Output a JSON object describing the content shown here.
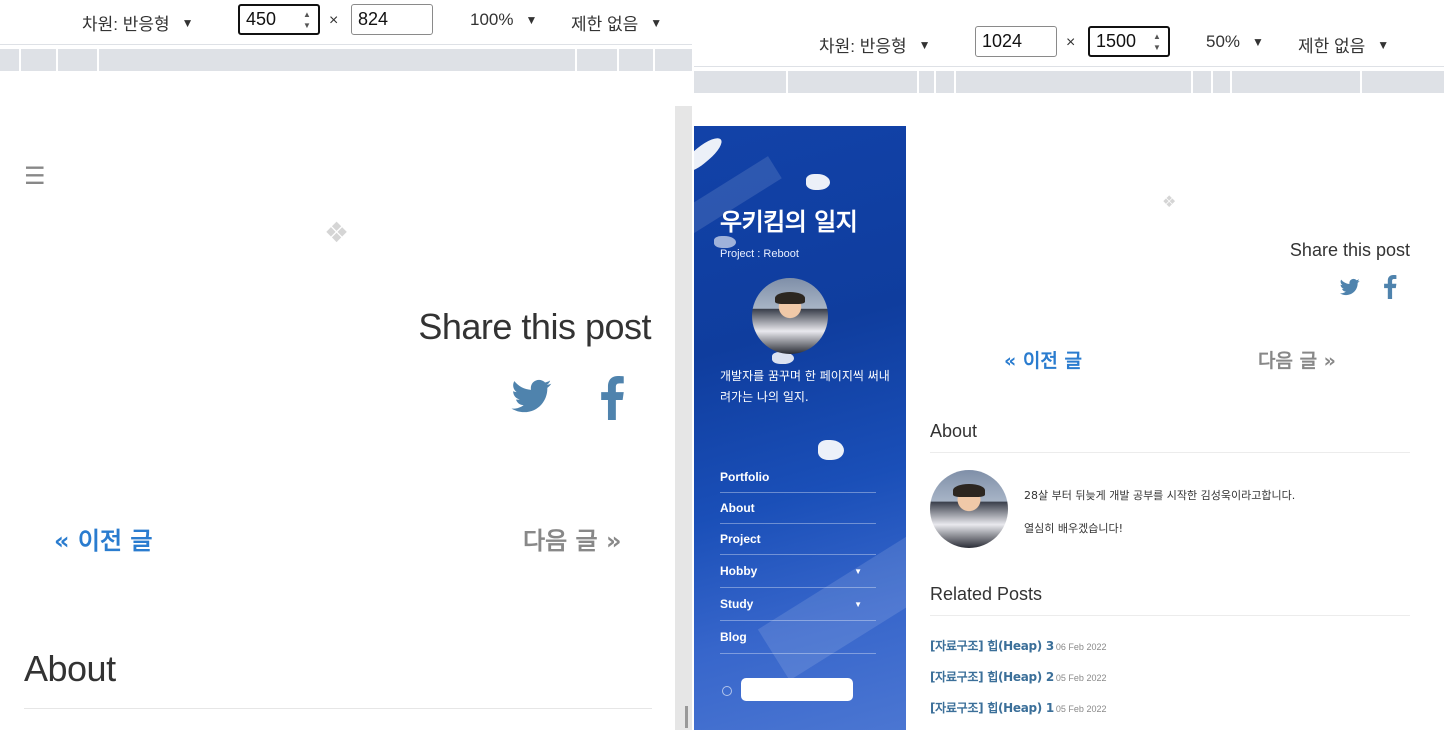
{
  "left_toolbar": {
    "dimension_label": "차원: 반응형",
    "width_value": "450",
    "height_value": "824",
    "times": "×",
    "zoom": "100%",
    "throttle": "제한 없음"
  },
  "right_toolbar": {
    "dimension_label": "차원: 반응형",
    "width_value": "1024",
    "height_value": "1500",
    "times": "×",
    "zoom": "50%",
    "throttle": "제한 없음"
  },
  "icons": {
    "menu": "☰",
    "diamond": "❖",
    "caret": "▼",
    "spin_up": "▲",
    "spin_down": "▼"
  },
  "mobile_view": {
    "share_title": "Share this post",
    "prev_post": "« 이전 글",
    "next_post": "다음 글 »",
    "about_title": "About"
  },
  "sidebar": {
    "blog_title": "우키킴의 일지",
    "subtitle": "Project : Reboot",
    "bio": "개발자를 꿈꾸며 한 페이지씩 써내려가는 나의 일지.",
    "menu": [
      {
        "label": "Portfolio",
        "has_submenu": false
      },
      {
        "label": "About",
        "has_submenu": false
      },
      {
        "label": "Project",
        "has_submenu": false
      },
      {
        "label": "Hobby",
        "has_submenu": true
      },
      {
        "label": "Study",
        "has_submenu": true
      },
      {
        "label": "Blog",
        "has_submenu": false
      }
    ],
    "submenu_caret": "▼",
    "search_placeholder": "",
    "colors": {
      "top": "#1242a8",
      "bottom": "#4b76d2"
    }
  },
  "desktop_view": {
    "share_title": "Share this post",
    "prev_post": "« 이전 글",
    "next_post": "다음 글 »",
    "about_title": "About",
    "about_line1": "28살 부터 뒤늦게 개발 공부를 시작한 김성욱이라고합니다.",
    "about_line2": "열심히 배우겠습니다!",
    "related_title": "Related Posts",
    "related_posts": [
      {
        "title": "[자료구조] 힙(Heap) 3",
        "date": "06 Feb 2022"
      },
      {
        "title": "[자료구조] 힙(Heap) 2",
        "date": "05 Feb 2022"
      },
      {
        "title": "[자료구조] 힙(Heap) 1",
        "date": "05 Feb 2022"
      }
    ]
  },
  "colors": {
    "link_blue": "#2a7ccf",
    "muted_gray": "#888888",
    "social_blue": "#4f83ad",
    "sidebar_blue": "#1242a8"
  }
}
